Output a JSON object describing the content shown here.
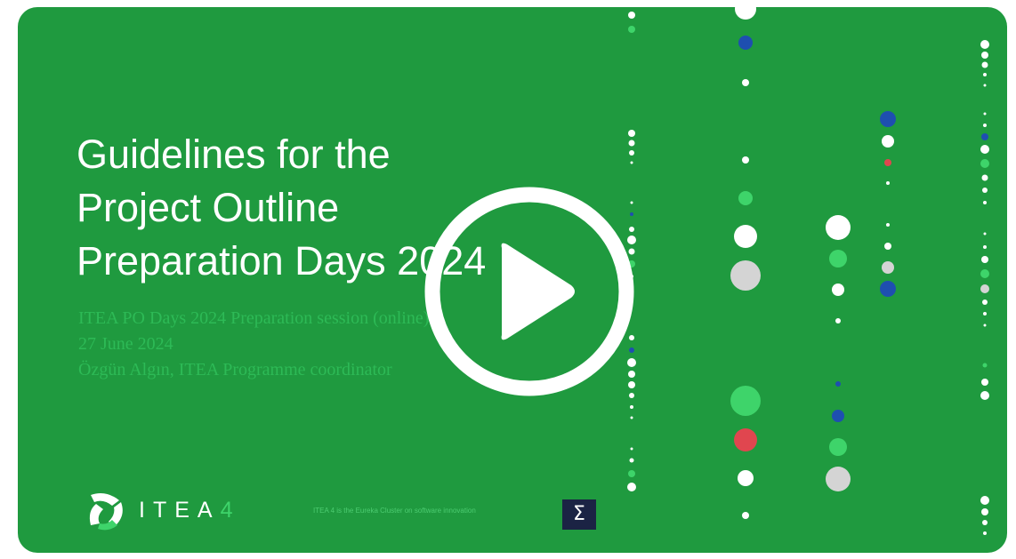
{
  "video": {
    "title_lines": [
      "Guidelines for the",
      "Project Outline",
      "Preparation Days 2024"
    ],
    "subtitle_lines": [
      "ITEA PO Days 2024 Preparation session (online)",
      "27 June 2024",
      "Özgün Algın, ITEA Programme coordinator"
    ],
    "logo_text": "ITEA",
    "logo_number": "4",
    "tagline": "ITEA 4 is the Eureka Cluster on software innovation",
    "badge_symbol": "Σ",
    "play_icon": "play-icon"
  },
  "colors": {
    "background": "#1f9a3f",
    "title": "#ffffff",
    "subtitle": "#2dba56",
    "accent_green": "#3ed46a",
    "dot_blue": "#1e4fb0",
    "dot_red": "#e0464f",
    "dot_gray": "#d4d4d4",
    "badge": "#1b2344"
  }
}
